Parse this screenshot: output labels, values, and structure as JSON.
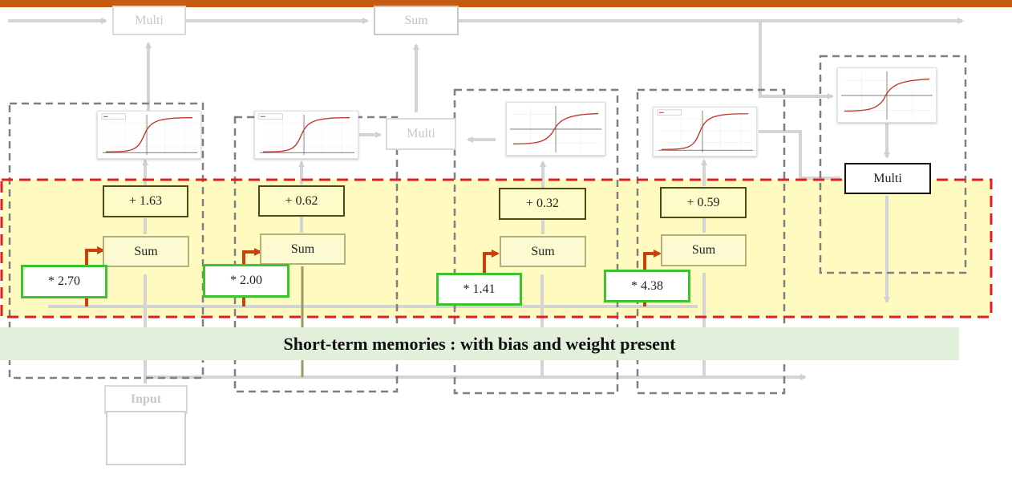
{
  "diagram": {
    "top_nodes": {
      "multi_label": "Multi",
      "sum_label": "Sum"
    },
    "middle_multi_label": "Multi",
    "right_multi_label": "Multi",
    "input_label": "Input",
    "units": [
      {
        "bias": "+ 1.63",
        "sum": "Sum",
        "weight": "* 2.70"
      },
      {
        "bias": "+ 0.62",
        "sum": "Sum",
        "weight": "* 2.00"
      },
      {
        "bias": "+ 0.32",
        "sum": "Sum",
        "weight": "* 1.41"
      },
      {
        "bias": "+ 0.59",
        "sum": "Sum",
        "weight": "* 4.38"
      }
    ],
    "activation_icons": [
      "sigmoid-graph-icon",
      "sigmoid-graph-icon",
      "tanh-graph-icon",
      "sigmoid-graph-icon",
      "tanh-graph-icon"
    ],
    "caption": "Short-term memories : with bias and weight present",
    "colors": {
      "top_bar": "#c55a11",
      "highlight_fill": "#fffbc0",
      "highlight_border": "#e02020",
      "weight_border": "#3ec22e",
      "weight_arrow": "#c9420b",
      "caption_band": "#e2efda"
    }
  }
}
